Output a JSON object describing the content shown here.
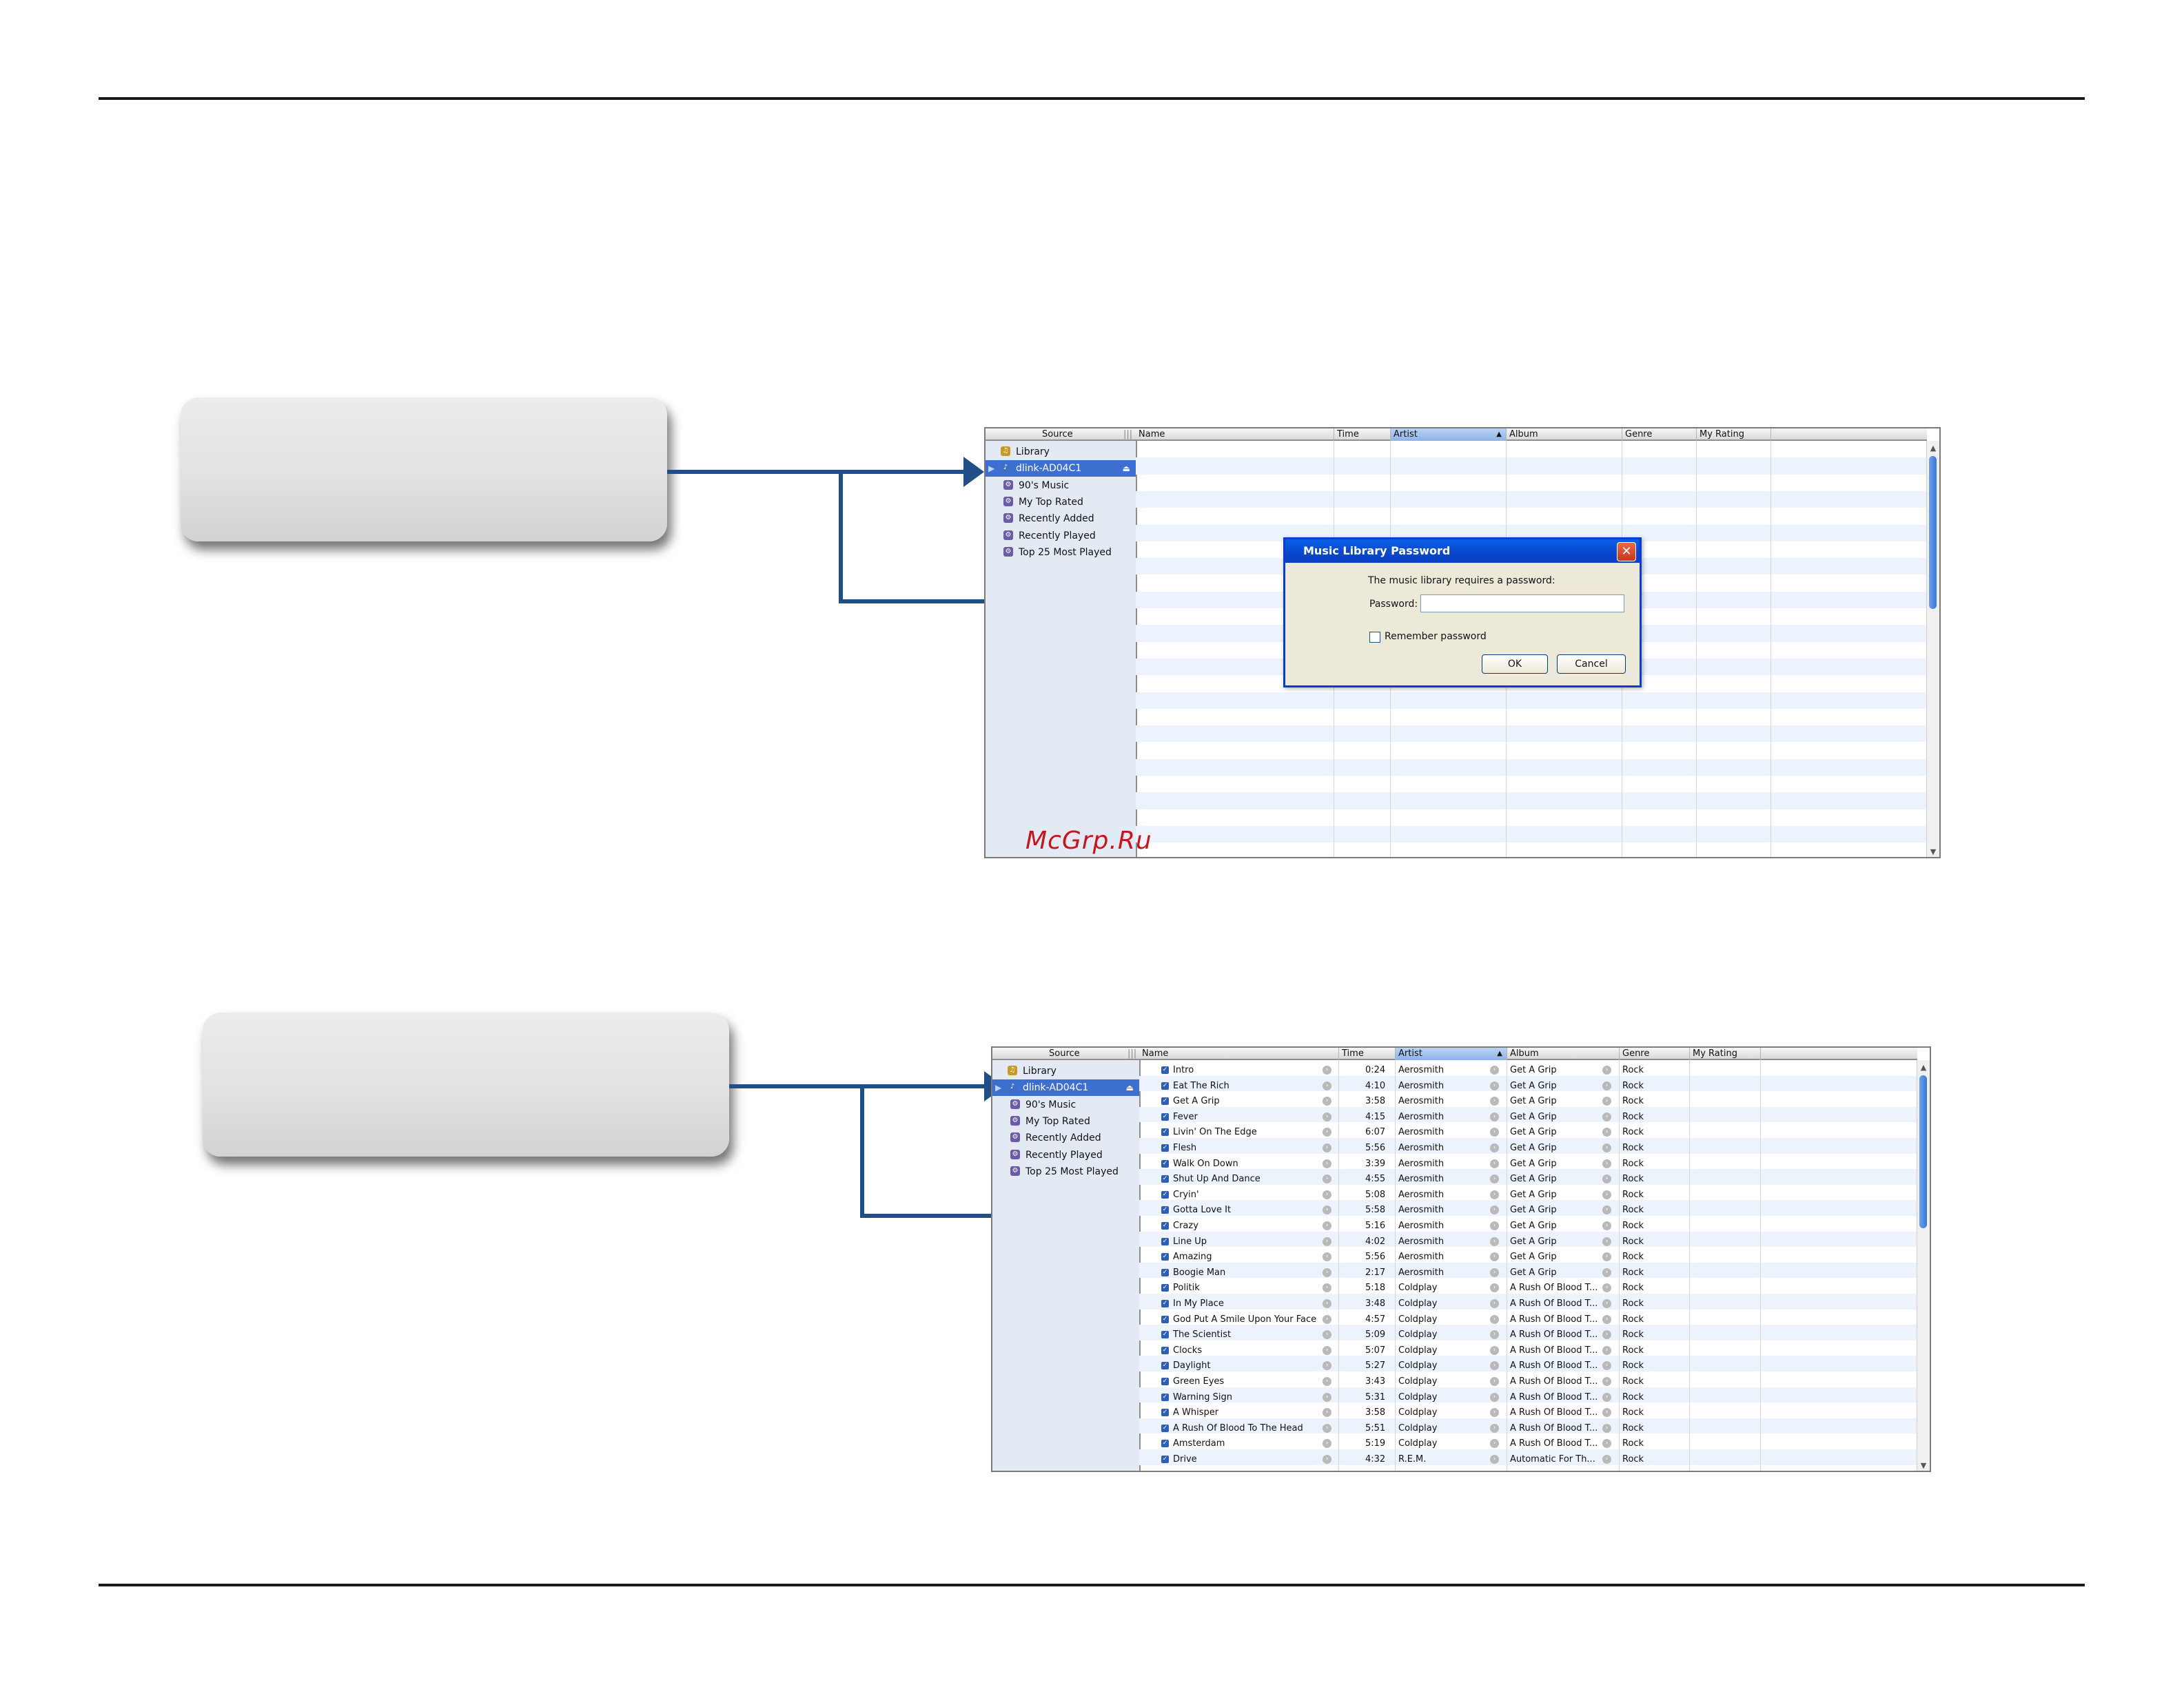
{
  "window1": {
    "source_header": "Source",
    "sources": [
      {
        "label": "Library",
        "icon": "library-icon"
      },
      {
        "label": "dlink-AD04C1",
        "icon": "shared-device-icon",
        "selected": true
      },
      {
        "label": "90's Music",
        "icon": "smart-playlist-icon"
      },
      {
        "label": "My Top Rated",
        "icon": "smart-playlist-icon"
      },
      {
        "label": "Recently Added",
        "icon": "smart-playlist-icon"
      },
      {
        "label": "Recently Played",
        "icon": "smart-playlist-icon"
      },
      {
        "label": "Top 25 Most Played",
        "icon": "smart-playlist-icon"
      }
    ],
    "columns": [
      "Name",
      "Time",
      "Artist",
      "Album",
      "Genre",
      "My Rating"
    ],
    "sorted_column": "Artist",
    "dialog": {
      "title": "Music Library Password",
      "message": "The music library requires a password:",
      "password_label": "Password:",
      "password_value": "",
      "remember_label": "Remember password",
      "remember_checked": false,
      "ok_label": "OK",
      "cancel_label": "Cancel"
    }
  },
  "window2": {
    "source_header": "Source",
    "sources": [
      {
        "label": "Library",
        "icon": "library-icon"
      },
      {
        "label": "dlink-AD04C1",
        "icon": "shared-device-icon",
        "selected": true
      },
      {
        "label": "90's Music",
        "icon": "smart-playlist-icon"
      },
      {
        "label": "My Top Rated",
        "icon": "smart-playlist-icon"
      },
      {
        "label": "Recently Added",
        "icon": "smart-playlist-icon"
      },
      {
        "label": "Recently Played",
        "icon": "smart-playlist-icon"
      },
      {
        "label": "Top 25 Most Played",
        "icon": "smart-playlist-icon"
      }
    ],
    "columns": [
      "Name",
      "Time",
      "Artist",
      "Album",
      "Genre",
      "My Rating"
    ],
    "sorted_column": "Artist",
    "tracks": [
      {
        "name": "Intro",
        "time": "0:24",
        "artist": "Aerosmith",
        "album": "Get A Grip",
        "genre": "Rock"
      },
      {
        "name": "Eat The Rich",
        "time": "4:10",
        "artist": "Aerosmith",
        "album": "Get A Grip",
        "genre": "Rock"
      },
      {
        "name": "Get A Grip",
        "time": "3:58",
        "artist": "Aerosmith",
        "album": "Get A Grip",
        "genre": "Rock"
      },
      {
        "name": "Fever",
        "time": "4:15",
        "artist": "Aerosmith",
        "album": "Get A Grip",
        "genre": "Rock"
      },
      {
        "name": "Livin' On The Edge",
        "time": "6:07",
        "artist": "Aerosmith",
        "album": "Get A Grip",
        "genre": "Rock"
      },
      {
        "name": "Flesh",
        "time": "5:56",
        "artist": "Aerosmith",
        "album": "Get A Grip",
        "genre": "Rock"
      },
      {
        "name": "Walk On Down",
        "time": "3:39",
        "artist": "Aerosmith",
        "album": "Get A Grip",
        "genre": "Rock"
      },
      {
        "name": "Shut Up And Dance",
        "time": "4:55",
        "artist": "Aerosmith",
        "album": "Get A Grip",
        "genre": "Rock"
      },
      {
        "name": "Cryin'",
        "time": "5:08",
        "artist": "Aerosmith",
        "album": "Get A Grip",
        "genre": "Rock"
      },
      {
        "name": "Gotta Love It",
        "time": "5:58",
        "artist": "Aerosmith",
        "album": "Get A Grip",
        "genre": "Rock"
      },
      {
        "name": "Crazy",
        "time": "5:16",
        "artist": "Aerosmith",
        "album": "Get A Grip",
        "genre": "Rock"
      },
      {
        "name": "Line Up",
        "time": "4:02",
        "artist": "Aerosmith",
        "album": "Get A Grip",
        "genre": "Rock"
      },
      {
        "name": "Amazing",
        "time": "5:56",
        "artist": "Aerosmith",
        "album": "Get A Grip",
        "genre": "Rock"
      },
      {
        "name": "Boogie Man",
        "time": "2:17",
        "artist": "Aerosmith",
        "album": "Get A Grip",
        "genre": "Rock"
      },
      {
        "name": "Politik",
        "time": "5:18",
        "artist": "Coldplay",
        "album": "A Rush Of Blood T...",
        "genre": "Rock"
      },
      {
        "name": "In My Place",
        "time": "3:48",
        "artist": "Coldplay",
        "album": "A Rush Of Blood T...",
        "genre": "Rock"
      },
      {
        "name": "God Put A Smile Upon Your Face",
        "time": "4:57",
        "artist": "Coldplay",
        "album": "A Rush Of Blood T...",
        "genre": "Rock"
      },
      {
        "name": "The Scientist",
        "time": "5:09",
        "artist": "Coldplay",
        "album": "A Rush Of Blood T...",
        "genre": "Rock"
      },
      {
        "name": "Clocks",
        "time": "5:07",
        "artist": "Coldplay",
        "album": "A Rush Of Blood T...",
        "genre": "Rock"
      },
      {
        "name": "Daylight",
        "time": "5:27",
        "artist": "Coldplay",
        "album": "A Rush Of Blood T...",
        "genre": "Rock"
      },
      {
        "name": "Green Eyes",
        "time": "3:43",
        "artist": "Coldplay",
        "album": "A Rush Of Blood T...",
        "genre": "Rock"
      },
      {
        "name": "Warning Sign",
        "time": "5:31",
        "artist": "Coldplay",
        "album": "A Rush Of Blood T...",
        "genre": "Rock"
      },
      {
        "name": "A Whisper",
        "time": "3:58",
        "artist": "Coldplay",
        "album": "A Rush Of Blood T...",
        "genre": "Rock"
      },
      {
        "name": "A Rush Of Blood To The Head",
        "time": "5:51",
        "artist": "Coldplay",
        "album": "A Rush Of Blood T...",
        "genre": "Rock"
      },
      {
        "name": "Amsterdam",
        "time": "5:19",
        "artist": "Coldplay",
        "album": "A Rush Of Blood T...",
        "genre": "Rock"
      },
      {
        "name": "Drive",
        "time": "4:32",
        "artist": "R.E.M.",
        "album": "Automatic For Th...",
        "genre": "Rock"
      }
    ]
  },
  "watermark": "McGrp.Ru",
  "colors": {
    "arrow": "#1f4f86",
    "selection": "#3d6fd1",
    "dialog_title": "#0a46cc",
    "watermark": "#c4161c"
  }
}
